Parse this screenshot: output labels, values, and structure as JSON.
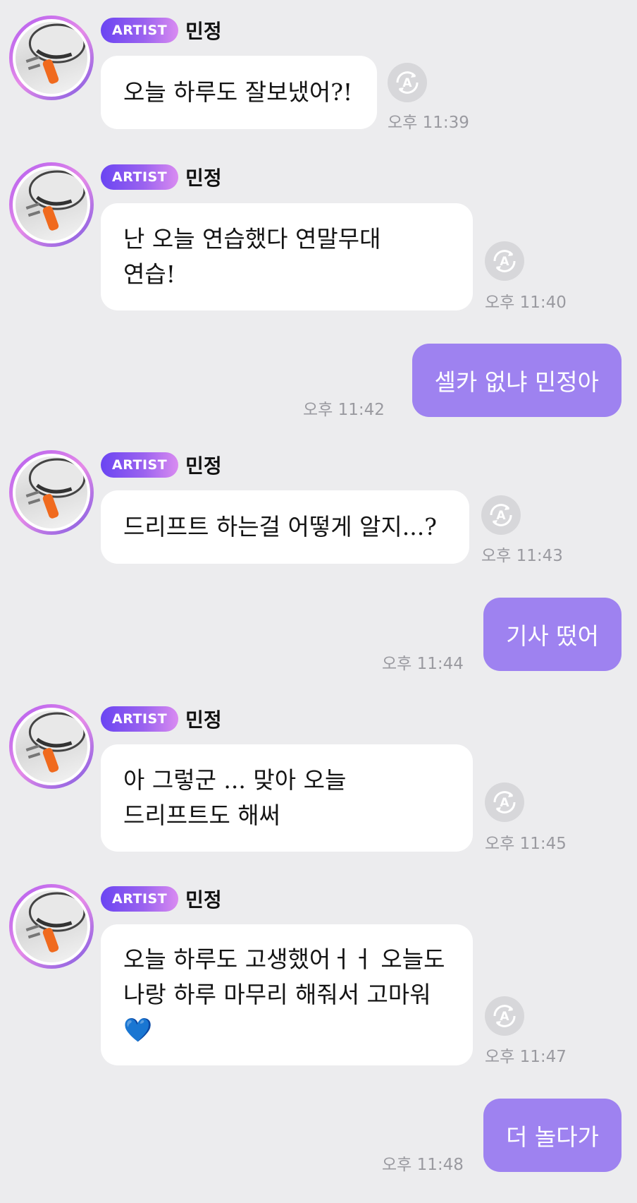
{
  "badge_label": "ARTIST",
  "artist_name": "민정",
  "messages": [
    {
      "type": "in",
      "lines": [
        "오늘 하루도 잘보냈어?!"
      ],
      "time": "오후 11:39"
    },
    {
      "type": "in",
      "lines": [
        "난 오늘 연습했다 연말무대",
        "연습!"
      ],
      "time": "오후 11:40"
    },
    {
      "type": "out",
      "text": "셀카 없냐 민정아",
      "time": "오후 11:42"
    },
    {
      "type": "in",
      "lines": [
        "드리프트 하는걸 어떻게 알지...?"
      ],
      "time": "오후 11:43"
    },
    {
      "type": "out",
      "text": "기사 떴어",
      "time": "오후 11:44"
    },
    {
      "type": "in",
      "lines": [
        "아 그렇군 ... 맞아 오늘",
        "드리프트도 해써"
      ],
      "time": "오후 11:45"
    },
    {
      "type": "in",
      "lines": [
        "오늘 하루도 고생했어ㅓㅓ 오늘도",
        "나랑 하루 마무리 해줘서 고마워",
        "💙"
      ],
      "time": "오후 11:47"
    },
    {
      "type": "out",
      "text": "더 놀다가",
      "time": "오후 11:48"
    }
  ],
  "colors": {
    "background": "#ececee",
    "outgoing_bubble": "#9e82f0",
    "incoming_bubble": "#ffffff",
    "badge_start": "#6a45f2",
    "badge_end": "#d98bf1"
  },
  "icons": {
    "translate": "translate-icon"
  }
}
